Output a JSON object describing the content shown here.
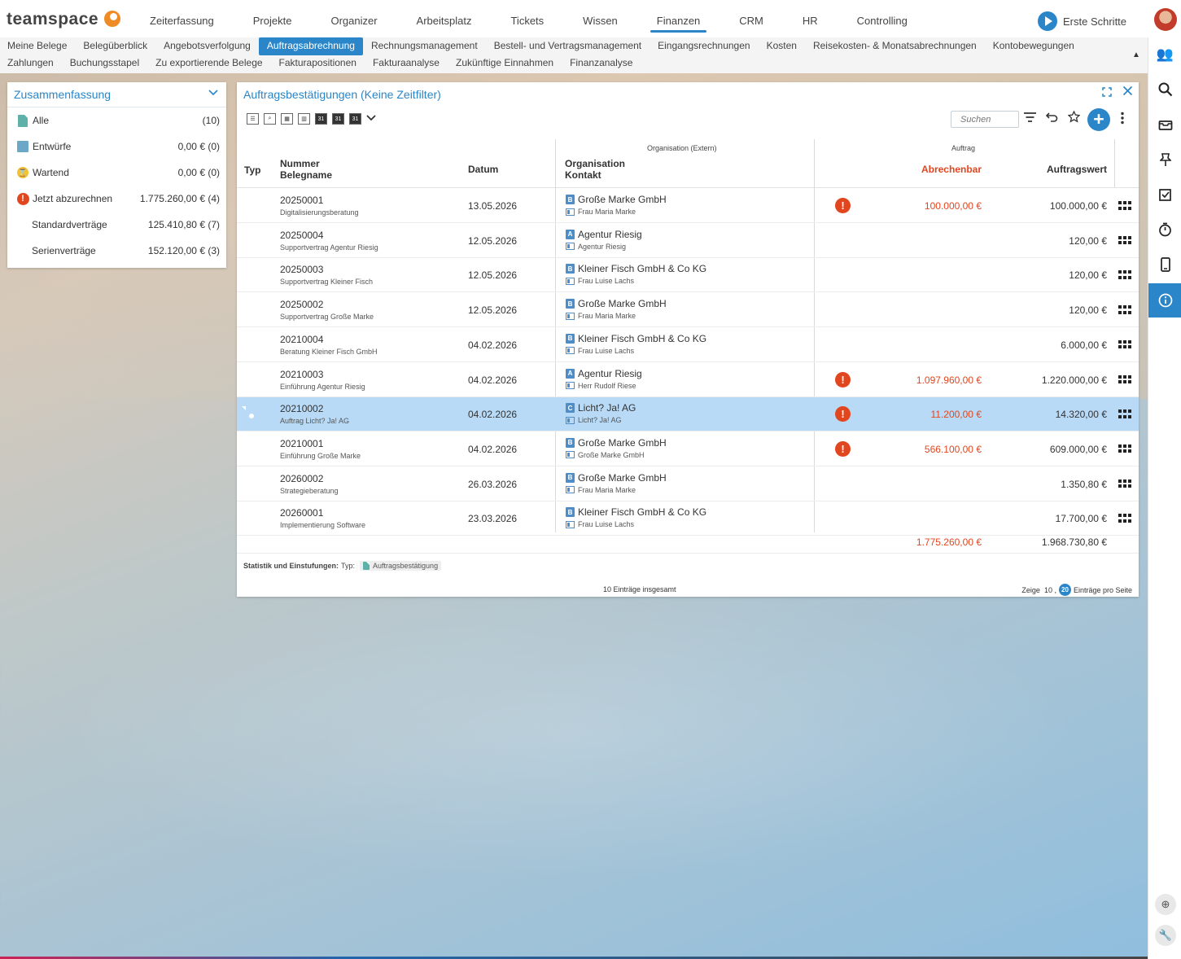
{
  "app": {
    "logo_text": "teamspace"
  },
  "main_nav": [
    "Zeiterfassung",
    "Projekte",
    "Organizer",
    "Arbeitsplatz",
    "Tickets",
    "Wissen",
    "Finanzen",
    "CRM",
    "HR",
    "Controlling"
  ],
  "main_nav_active": "Finanzen",
  "first_steps": "Erste Schritte",
  "sub_nav_row1": [
    "Meine Belege",
    "Belegüberblick",
    "Angebotsverfolgung",
    "Auftragsabrechnung",
    "Rechnungsmanagement",
    "Bestell- und Vertragsmanagement",
    "Eingangsrechnungen",
    "Kosten",
    "Reisekosten- & Monatsabrechnungen",
    "Kontobewegungen"
  ],
  "sub_nav_row2": [
    "Zahlungen",
    "Buchungsstapel",
    "Zu exportierende Belege",
    "Fakturapositionen",
    "Fakturaanalyse",
    "Zukünftige Einnahmen",
    "Finanzanalyse"
  ],
  "sub_nav_active": "Auftragsabrechnung",
  "summary": {
    "title": "Zusammenfassung",
    "rows": [
      {
        "label": "Alle",
        "value": "(10)",
        "icon": "document-icon"
      },
      {
        "label": "Entwürfe",
        "value": "0,00 € (0)",
        "icon": "draft-icon"
      },
      {
        "label": "Wartend",
        "value": "0,00 € (0)",
        "icon": "waiting-icon"
      },
      {
        "label": "Jetzt abzurechnen",
        "value": "1.775.260,00 € (4)",
        "icon": "alert-icon"
      },
      {
        "label": "Standardverträge",
        "value": "125.410,80 € (7)",
        "icon": ""
      },
      {
        "label": "Serienverträge",
        "value": "152.120,00 € (3)",
        "icon": ""
      }
    ]
  },
  "panel": {
    "title": "Auftragsbestätigungen (Keine Zeitfilter)",
    "search_placeholder": "Suchen",
    "group_org": "Organisation (Extern)",
    "group_auftrag": "Auftrag",
    "headers": {
      "typ": "Typ",
      "nummer": "Nummer",
      "belegname": "Belegname",
      "datum": "Datum",
      "organisation": "Organisation",
      "kontakt": "Kontakt",
      "abrechenbar": "Abrechenbar",
      "auftragswert": "Auftragswert"
    },
    "rows": [
      {
        "nummer": "20250001",
        "belegname": "Digitalisierungsberatung",
        "datum": "13.05.2026",
        "org": "Große Marke GmbH",
        "org_badge": "B",
        "kontakt": "Frau Maria Marke",
        "alert": true,
        "abrechenbar": "100.000,00 €",
        "auftragswert": "100.000,00 €",
        "selected": false
      },
      {
        "nummer": "20250004",
        "belegname": "Supportvertrag Agentur Riesig",
        "datum": "12.05.2026",
        "org": "Agentur Riesig",
        "org_badge": "A",
        "kontakt": "Agentur Riesig",
        "alert": false,
        "abrechenbar": "",
        "auftragswert": "120,00 €",
        "selected": false
      },
      {
        "nummer": "20250003",
        "belegname": "Supportvertrag Kleiner Fisch",
        "datum": "12.05.2026",
        "org": "Kleiner Fisch GmbH & Co KG",
        "org_badge": "B",
        "kontakt": "Frau Luise Lachs",
        "alert": false,
        "abrechenbar": "",
        "auftragswert": "120,00 €",
        "selected": false
      },
      {
        "nummer": "20250002",
        "belegname": "Supportvertrag Große Marke",
        "datum": "12.05.2026",
        "org": "Große Marke GmbH",
        "org_badge": "B",
        "kontakt": "Frau Maria Marke",
        "alert": false,
        "abrechenbar": "",
        "auftragswert": "120,00 €",
        "selected": false
      },
      {
        "nummer": "20210004",
        "belegname": "Beratung Kleiner Fisch GmbH",
        "datum": "04.02.2026",
        "org": "Kleiner Fisch GmbH & Co KG",
        "org_badge": "B",
        "kontakt": "Frau Luise Lachs",
        "alert": false,
        "abrechenbar": "",
        "auftragswert": "6.000,00 €",
        "selected": false
      },
      {
        "nummer": "20210003",
        "belegname": "Einführung Agentur Riesig",
        "datum": "04.02.2026",
        "org": "Agentur Riesig",
        "org_badge": "A",
        "kontakt": "Herr Rudolf Riese",
        "alert": true,
        "abrechenbar": "1.097.960,00 €",
        "auftragswert": "1.220.000,00 €",
        "selected": false
      },
      {
        "nummer": "20210002",
        "belegname": "Auftrag Licht? Ja! AG",
        "datum": "04.02.2026",
        "org": "Licht? Ja! AG",
        "org_badge": "C",
        "kontakt": "Licht? Ja! AG",
        "alert": true,
        "abrechenbar": "11.200,00 €",
        "auftragswert": "14.320,00 €",
        "selected": true
      },
      {
        "nummer": "20210001",
        "belegname": "Einführung Große Marke",
        "datum": "04.02.2026",
        "org": "Große Marke GmbH",
        "org_badge": "B",
        "kontakt": "Große Marke GmbH",
        "alert": true,
        "abrechenbar": "566.100,00 €",
        "auftragswert": "609.000,00 €",
        "selected": false
      },
      {
        "nummer": "20260002",
        "belegname": "Strategieberatung",
        "datum": "26.03.2026",
        "org": "Große Marke GmbH",
        "org_badge": "B",
        "kontakt": "Frau Maria Marke",
        "alert": false,
        "abrechenbar": "",
        "auftragswert": "1.350,80 €",
        "selected": false
      },
      {
        "nummer": "20260001",
        "belegname": "Implementierung Software",
        "datum": "23.03.2026",
        "org": "Kleiner Fisch GmbH & Co KG",
        "org_badge": "B",
        "kontakt": "Frau Luise Lachs",
        "alert": false,
        "abrechenbar": "",
        "auftragswert": "17.700,00 €",
        "selected": false
      }
    ],
    "total_abrechenbar": "1.775.260,00 €",
    "total_auftragswert": "1.968.730,80 €",
    "stat_label": "Statistik und Einstufungen:",
    "stat_typ": "Typ:",
    "stat_tag": "Auftragsbestätigung",
    "footer_count": "10 Einträge insgesamt",
    "footer_show": "Zeige",
    "footer_opt1": "10 ,",
    "footer_opt2": "20",
    "footer_suffix": "Einträge pro Seite"
  },
  "colors": {
    "accent": "#2a86c8",
    "alert": "#e2461f",
    "selected_row": "#b8daf6"
  }
}
